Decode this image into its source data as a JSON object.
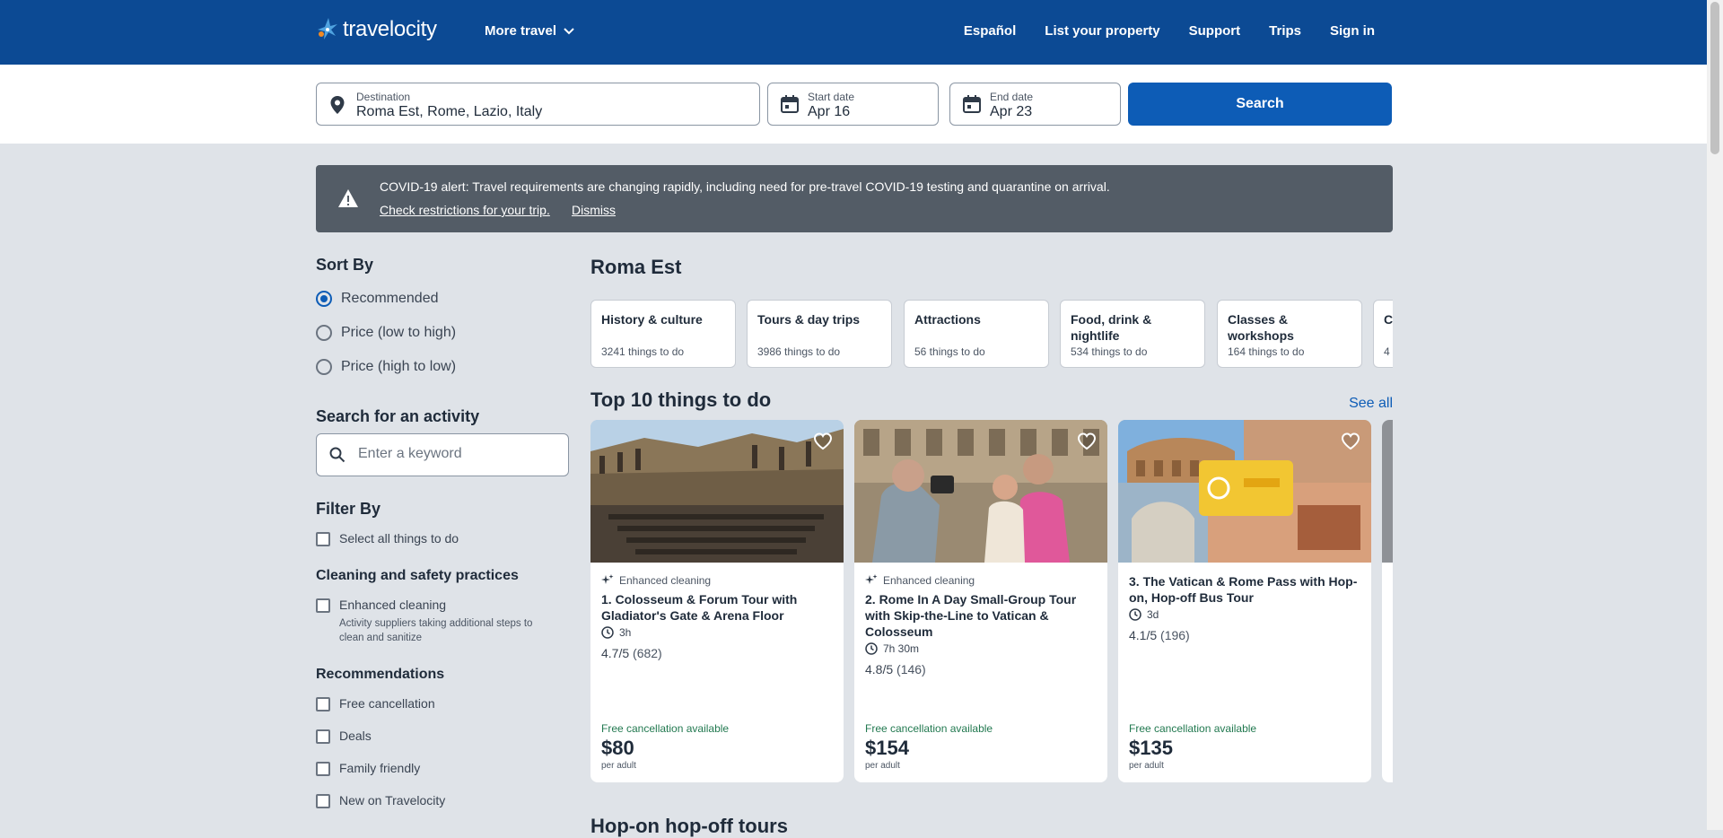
{
  "brand": {
    "name": "travelocity"
  },
  "nav": {
    "more_travel": "More travel",
    "links": [
      "Español",
      "List your property",
      "Support",
      "Trips",
      "Sign in"
    ]
  },
  "search": {
    "destination_label": "Destination",
    "destination_value": "Roma Est, Rome, Lazio, Italy",
    "start_label": "Start date",
    "start_value": "Apr 16",
    "end_label": "End date",
    "end_value": "Apr 23",
    "button": "Search"
  },
  "alert": {
    "message": "COVID-19 alert: Travel requirements are changing rapidly, including need for pre-travel COVID-19 testing and quarantine on arrival.",
    "link1": "Check restrictions for your trip.",
    "link2": "Dismiss"
  },
  "sidebar": {
    "sort_title": "Sort By",
    "sort_options": [
      "Recommended",
      "Price (low to high)",
      "Price (high to low)"
    ],
    "sort_selected": "Recommended",
    "search_title": "Search for an activity",
    "search_placeholder": "Enter a keyword",
    "filter_title": "Filter By",
    "select_all": "Select all things to do",
    "cleaning_title": "Cleaning and safety practices",
    "cleaning_option": "Enhanced cleaning",
    "cleaning_desc": "Activity suppliers taking additional steps to clean and sanitize",
    "rec_title": "Recommendations",
    "rec_options": [
      "Free cancellation",
      "Deals",
      "Family friendly",
      "New on Travelocity"
    ]
  },
  "main": {
    "heading": "Roma Est",
    "categories": [
      {
        "title": "History & culture",
        "count": "3241 things to do"
      },
      {
        "title": "Tours & day trips",
        "count": "3986 things to do"
      },
      {
        "title": "Attractions",
        "count": "56 things to do"
      },
      {
        "title": "Food, drink & nightlife",
        "count": "534 things to do"
      },
      {
        "title": "Classes & workshops",
        "count": "164 things to do"
      },
      {
        "title": "C",
        "count": "4"
      }
    ],
    "top_title": "Top 10 things to do",
    "see_all": "See all",
    "cards": [
      {
        "badge": "Enhanced cleaning",
        "title": "1. Colosseum & Forum Tour with Gladiator's Gate & Arena Floor",
        "duration": "3h",
        "rating": "4.7/5",
        "reviews": "(682)",
        "free": "Free cancellation available",
        "price": "$80",
        "per": "per adult"
      },
      {
        "badge": "Enhanced cleaning",
        "title": "2. Rome In A Day Small-Group Tour with Skip-the-Line to Vatican & Colosseum",
        "duration": "7h 30m",
        "rating": "4.8/5",
        "reviews": "(146)",
        "free": "Free cancellation available",
        "price": "$154",
        "per": "per adult"
      },
      {
        "badge": "",
        "title": "3. The Vatican & Rome Pass with Hop-on, Hop-off Bus Tour",
        "duration": "3d",
        "rating": "4.1/5",
        "reviews": "(196)",
        "free": "Free cancellation available",
        "price": "$135",
        "per": "per adult"
      }
    ],
    "next_section": "Hop-on hop-off tours"
  }
}
